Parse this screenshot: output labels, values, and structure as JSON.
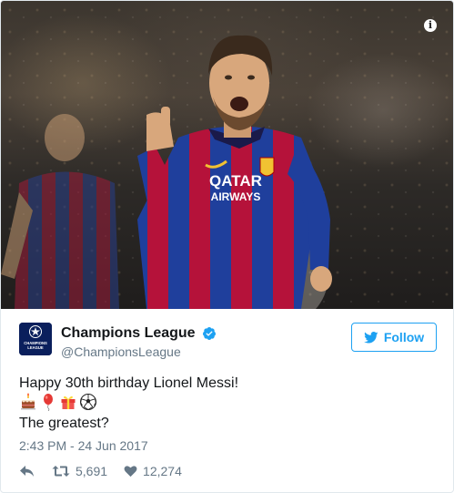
{
  "account": {
    "display_name": "Champions League",
    "handle": "@ChampionsLeague",
    "avatar_text_top": "CHAMPIONS",
    "avatar_text_bottom": "LEAGUE",
    "verified": true
  },
  "follow_button": {
    "label": "Follow"
  },
  "tweet": {
    "line1": "Happy 30th birthday Lionel Messi!",
    "emojis": [
      "birthday-cake-icon",
      "balloon-icon",
      "gift-icon",
      "soccer-ball-icon"
    ],
    "line3": "The greatest?",
    "timestamp": "2:43 PM - 24 Jun 2017"
  },
  "photo": {
    "shirt_sponsor_line1": "QATAR",
    "shirt_sponsor_line2": "AIRWAYS"
  },
  "stats": {
    "retweets": "5,691",
    "likes": "12,274"
  },
  "colors": {
    "accent": "#1da1f2",
    "secondary_text": "#657786",
    "barca_blue": "#1f3f9c",
    "barca_red": "#b5123a"
  }
}
